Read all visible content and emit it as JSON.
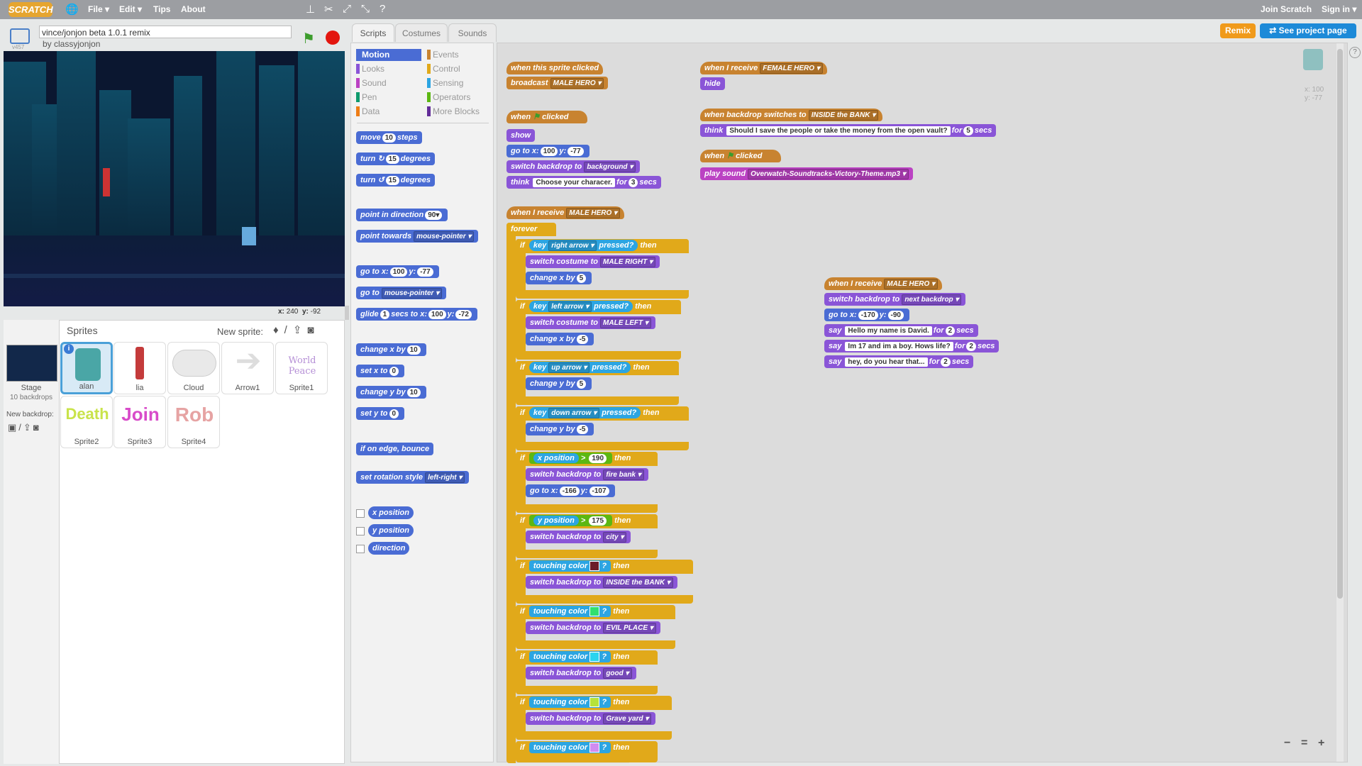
{
  "topbar": {
    "logo": "SCRATCH",
    "menus": [
      "File ▾",
      "Edit ▾",
      "Tips",
      "About"
    ],
    "right_links": [
      "Join Scratch",
      "Sign in ▾"
    ]
  },
  "project": {
    "title": "vince/jonjon beta 1.0.1 remix",
    "author": "by classyjonjon",
    "version": "v457"
  },
  "buttons": {
    "remix": "Remix",
    "see_project": "See project page"
  },
  "stage_readout": {
    "x_label": "x:",
    "x": "240",
    "y_label": "y:",
    "y": "-92"
  },
  "sprite_readout": {
    "x": "x: 100",
    "y": "y: -77"
  },
  "sprites_panel": {
    "title": "Sprites",
    "new_sprite": "New sprite:",
    "stage_label": "Stage",
    "stage_sub": "10 backdrops",
    "new_backdrop": "New backdrop:",
    "sprites": [
      {
        "name": "alan",
        "thumb": "robot"
      },
      {
        "name": "lia",
        "thumb": "girl"
      },
      {
        "name": "Cloud",
        "thumb": "cloud"
      },
      {
        "name": "Arrow1",
        "thumb": "arrow"
      },
      {
        "name": "Sprite1",
        "thumb": "World Peace",
        "color": "#b58fd6"
      },
      {
        "name": "Sprite2",
        "thumb": "Death",
        "color": "#c9e34a"
      },
      {
        "name": "Sprite3",
        "thumb": "Join",
        "color": "#d84bc9"
      },
      {
        "name": "Sprite4",
        "thumb": "Rob",
        "color": "#e6a3a3"
      }
    ]
  },
  "tabs": [
    "Scripts",
    "Costumes",
    "Sounds"
  ],
  "categories": [
    {
      "name": "Motion",
      "color": "#4a6cd4"
    },
    {
      "name": "Events",
      "color": "#c88330"
    },
    {
      "name": "Looks",
      "color": "#8a55d7"
    },
    {
      "name": "Control",
      "color": "#e1a91a"
    },
    {
      "name": "Sound",
      "color": "#bb42c3"
    },
    {
      "name": "Sensing",
      "color": "#2ca5e2"
    },
    {
      "name": "Pen",
      "color": "#0e9a6c"
    },
    {
      "name": "Operators",
      "color": "#5cb712"
    },
    {
      "name": "Data",
      "color": "#ee7d16"
    },
    {
      "name": "More Blocks",
      "color": "#632d99"
    }
  ],
  "palette_blocks": {
    "move": [
      "move",
      "10",
      "steps"
    ],
    "turn_right": [
      "turn",
      "15",
      "degrees"
    ],
    "turn_left": [
      "turn",
      "15",
      "degrees"
    ],
    "point_dir": [
      "point in direction",
      "90▾"
    ],
    "point_towards": [
      "point towards",
      "mouse-pointer ▾"
    ],
    "goto_xy": [
      "go to x:",
      "100",
      "y:",
      "-77"
    ],
    "goto": [
      "go to",
      "mouse-pointer ▾"
    ],
    "glide": [
      "glide",
      "1",
      "secs to x:",
      "100",
      "y:",
      "-72"
    ],
    "change_x": [
      "change x by",
      "10"
    ],
    "set_x": [
      "set x to",
      "0"
    ],
    "change_y": [
      "change y by",
      "10"
    ],
    "set_y": [
      "set y to",
      "0"
    ],
    "bounce": "if on edge, bounce",
    "rotation": [
      "set rotation style",
      "left-right ▾"
    ],
    "x_position": "x position",
    "y_position": "y position",
    "direction": "direction"
  },
  "scripts": {
    "s1": {
      "hat": "when this sprite clicked",
      "b1": "broadcast",
      "b1v": "MALE HERO ▾"
    },
    "s2": {
      "hat1": "when",
      "hat2": "clicked",
      "show": "show",
      "goto": [
        "go to x:",
        "100",
        "y:",
        "-77"
      ],
      "switch": [
        "switch backdrop to",
        "background ▾"
      ],
      "think": [
        "think",
        "Choose your characer.",
        "for",
        "3",
        "secs"
      ]
    },
    "s3": {
      "hat": "when I receive",
      "hatv": "MALE HERO ▾",
      "forever": "forever",
      "if": "if",
      "then": "then",
      "key": "key",
      "pressed": "pressed?",
      "k1": "right arrow ▾",
      "c1": [
        "switch costume to",
        "MALE RIGHT ▾"
      ],
      "x1": [
        "change x by",
        "5"
      ],
      "k2": "left arrow ▾",
      "c2": [
        "switch costume to",
        "MALE LEFT ▾"
      ],
      "x2": [
        "change x by",
        "-5"
      ],
      "k3": "up arrow ▾",
      "y3": [
        "change y by",
        "5"
      ],
      "k4": "down arrow ▾",
      "y4": [
        "change y by",
        "-5"
      ],
      "xpos": "x position",
      "gt": ">",
      "v190": "190",
      "sb1": [
        "switch backdrop to",
        "fire bank ▾"
      ],
      "g1": [
        "go to x:",
        "-166",
        "y:",
        "-107"
      ],
      "ypos": "y position",
      "v175": "175",
      "sb2": [
        "switch backdrop to",
        "city ▾"
      ],
      "touching": "touching color",
      "q": "?",
      "sb3": [
        "switch backdrop to",
        "INSIDE the BANK ▾"
      ],
      "sb4": [
        "switch backdrop to",
        "EVIL PLACE ▾"
      ],
      "sb5": [
        "switch backdrop to",
        "good ▾"
      ],
      "sb6": [
        "switch backdrop to",
        "Grave yard ▾"
      ],
      "colors": [
        "#6b1d2a",
        "#30e070",
        "#2ad4f0",
        "#b6e33a",
        "#d08cf0"
      ]
    },
    "s4": {
      "hat": "when I receive",
      "hatv": "FEMALE HERO ▾",
      "b1": "hide"
    },
    "s5": {
      "hat": "when backdrop switches to",
      "hatv": "INSIDE the BANK ▾",
      "think": [
        "think",
        "Should I save the people or take the money from the open vault?",
        "for",
        "5",
        "secs"
      ]
    },
    "s6": {
      "hat1": "when",
      "hat2": "clicked",
      "play": [
        "play sound",
        "Overwatch-Soundtracks-Victory-Theme.mp3 ▾"
      ]
    },
    "s7": {
      "hat": "when I receive",
      "hatv": "MALE HERO ▾",
      "sb": [
        "switch backdrop to",
        "next backdrop ▾"
      ],
      "goto": [
        "go to x:",
        "-170",
        "y:",
        "-90"
      ],
      "say1": [
        "say",
        "Hello my name is David.",
        "for",
        "2",
        "secs"
      ],
      "say2": [
        "say",
        "Im 17 and im a boy. Hows life?",
        "for",
        "2",
        "secs"
      ],
      "say3": [
        "say",
        "hey, do you hear that...",
        "for",
        "2",
        "secs"
      ]
    }
  },
  "zoom": {
    "out": "−",
    "reset": "=",
    "in": "+"
  }
}
